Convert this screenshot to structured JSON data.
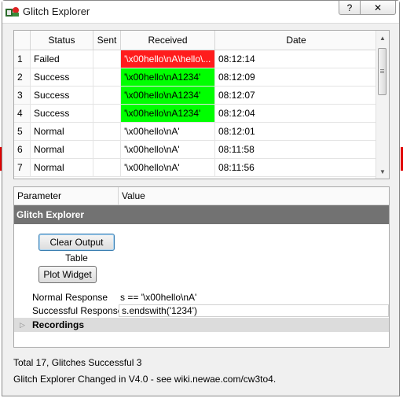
{
  "window": {
    "title": "Glitch Explorer",
    "help_label": "?",
    "close_label": "✕"
  },
  "table": {
    "columns": [
      "",
      "Status",
      "Sent",
      "Received",
      "Date"
    ],
    "rows": [
      {
        "num": "1",
        "status": "Failed",
        "sent": "",
        "received": "'\\x00hello\\nA\\hello\\...",
        "date": "08:12:14",
        "color": "#ff1c1c",
        "text_color": "#ffffff"
      },
      {
        "num": "2",
        "status": "Success",
        "sent": "",
        "received": "'\\x00hello\\nA1234'",
        "date": "08:12:09",
        "color": "#00ff00",
        "text_color": "#000000"
      },
      {
        "num": "3",
        "status": "Success",
        "sent": "",
        "received": "'\\x00hello\\nA1234'",
        "date": "08:12:07",
        "color": "#00ff00",
        "text_color": "#000000"
      },
      {
        "num": "4",
        "status": "Success",
        "sent": "",
        "received": "'\\x00hello\\nA1234'",
        "date": "08:12:04",
        "color": "#00ff00",
        "text_color": "#000000"
      },
      {
        "num": "5",
        "status": "Normal",
        "sent": "",
        "received": "'\\x00hello\\nA'",
        "date": "08:12:01",
        "color": "#ffffff",
        "text_color": "#000000"
      },
      {
        "num": "6",
        "status": "Normal",
        "sent": "",
        "received": "'\\x00hello\\nA'",
        "date": "08:11:58",
        "color": "#ffffff",
        "text_color": "#000000"
      },
      {
        "num": "7",
        "status": "Normal",
        "sent": "",
        "received": "'\\x00hello\\nA'",
        "date": "08:11:56",
        "color": "#ffffff",
        "text_color": "#000000"
      }
    ]
  },
  "params": {
    "header_parameter": "Parameter",
    "header_value": "Value",
    "group_title": "Glitch Explorer",
    "clear_button": "Clear Output Table",
    "plot_button": "Plot Widget",
    "normal_label": "Normal Response",
    "normal_value": "s == '\\x00hello\\nA'",
    "success_label": "Successful Response",
    "success_value": "s.endswith('1234')",
    "recordings_label": "Recordings"
  },
  "status": {
    "summary": "Total 17, Glitches Successful 3",
    "notice": "Glitch Explorer Changed in V4.0 - see wiki.newae.com/cw3to4."
  }
}
